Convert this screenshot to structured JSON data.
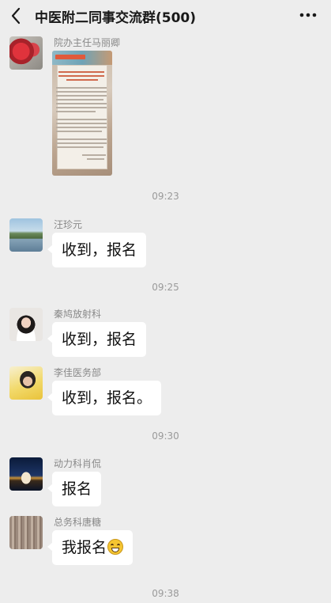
{
  "header": {
    "title": "中医附二同事交流群(500)"
  },
  "messages": [
    {
      "sender": "院办主任马丽卿",
      "type": "document-image"
    },
    {
      "sender": "汪珍元",
      "text": "收到，报名"
    },
    {
      "sender": "秦鸠放射科",
      "text": "收到，报名"
    },
    {
      "sender": "李佳医务部",
      "text": "收到，报名。"
    },
    {
      "sender": "动力科肖侃",
      "text": "报名"
    },
    {
      "sender": "总务科唐糖",
      "text": "我报名",
      "emoji": "grinning-emoji"
    }
  ],
  "timestamps": [
    "09:23",
    "09:25",
    "09:30",
    "09:38"
  ]
}
